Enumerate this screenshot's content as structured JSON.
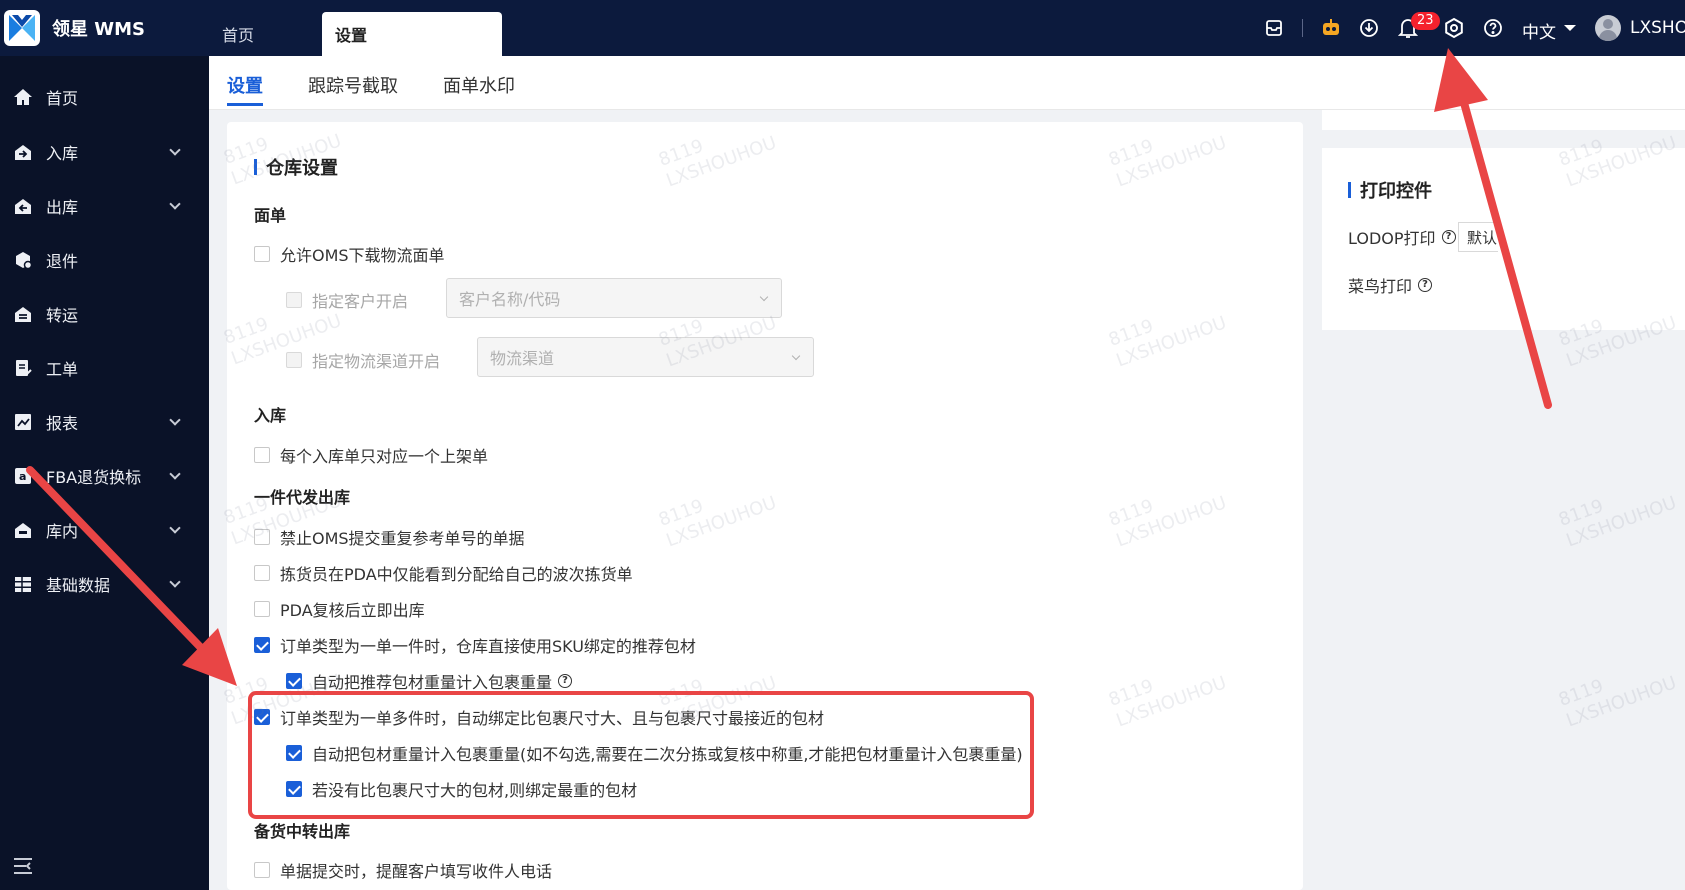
{
  "app": {
    "title": "领星 WMS"
  },
  "top_tabs": [
    {
      "label": "首页"
    },
    {
      "label": "设置"
    }
  ],
  "header": {
    "notification_count": "23",
    "language": "中文",
    "username": "LXSHO"
  },
  "sidebar": {
    "items": [
      {
        "label": "首页",
        "icon": "home-icon",
        "expandable": false
      },
      {
        "label": "入库",
        "icon": "inbound-icon",
        "expandable": true
      },
      {
        "label": "出库",
        "icon": "outbound-icon",
        "expandable": true
      },
      {
        "label": "退件",
        "icon": "return-icon",
        "expandable": false
      },
      {
        "label": "转运",
        "icon": "transfer-icon",
        "expandable": false
      },
      {
        "label": "工单",
        "icon": "workorder-icon",
        "expandable": false
      },
      {
        "label": "报表",
        "icon": "report-icon",
        "expandable": true
      },
      {
        "label": "FBA退货换标",
        "icon": "amazon-icon",
        "expandable": true
      },
      {
        "label": "库内",
        "icon": "warehouse-icon",
        "expandable": true
      },
      {
        "label": "基础数据",
        "icon": "database-icon",
        "expandable": true
      }
    ]
  },
  "sub_tabs": [
    {
      "label": "设置",
      "active": true
    },
    {
      "label": "跟踪号截取",
      "active": false
    },
    {
      "label": "面单水印",
      "active": false
    }
  ],
  "warehouse_settings": {
    "title": "仓库设置",
    "groups": {
      "label_group": "面单",
      "allow_oms": "允许OMS下载物流面单",
      "specify_customer": "指定客户开启",
      "customer_placeholder": "客户名称/代码",
      "specify_channel": "指定物流渠道开启",
      "channel_placeholder": "物流渠道",
      "inbound_group": "入库",
      "inbound_one_shelf": "每个入库单只对应一个上架单",
      "dropship_group": "一件代发出库",
      "opt1": "禁止OMS提交重复参考单号的单据",
      "opt2": "拣货员在PDA中仅能看到分配给自己的波次拣货单",
      "opt3": "PDA复核后立即出库",
      "opt4": "订单类型为一单一件时，仓库直接使用SKU绑定的推荐包材",
      "opt4_sub": "自动把推荐包材重量计入包裹重量",
      "opt5": "订单类型为一单多件时，自动绑定比包裹尺寸大、且与包裹尺寸最接近的包材",
      "opt5_sub1": "自动把包材重量计入包裹重量(如不勾选,需要在二次分拣或复核中称重,才能把包材重量计入包裹重量)",
      "opt5_sub2": "若没有比包裹尺寸大的包材,则绑定最重的包材",
      "stocking_group": "备货中转出库",
      "opt6": "单据提交时，提醒客户填写收件人电话"
    }
  },
  "print_settings": {
    "title": "打印控件",
    "lodop": "LODOP打印",
    "lodop_value": "默认",
    "cainiao": "菜鸟打印"
  },
  "watermark": {
    "line1": "8119",
    "line2": "LXSHOUHOU"
  },
  "colors": {
    "accent": "#1a5fd8",
    "topbar": "#0c1a3d",
    "sidebar": "#0a1228",
    "annotation": "#e94545",
    "badge": "#f5222d"
  }
}
